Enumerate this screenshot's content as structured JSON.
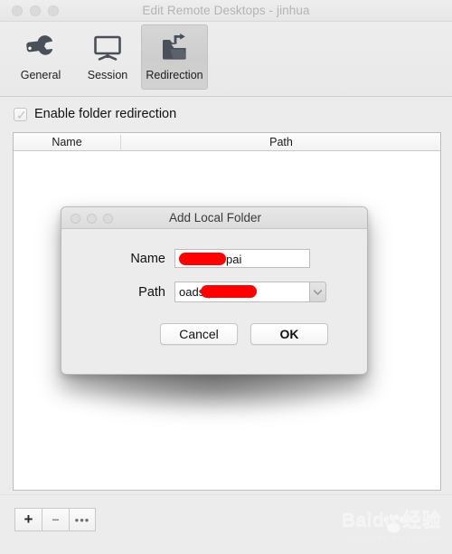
{
  "window": {
    "title": "Edit Remote Desktops - jinhua",
    "traffic_lights": [
      "close-button",
      "minimize-button",
      "zoom-button"
    ]
  },
  "toolbar": {
    "items": [
      {
        "label": "General",
        "icon": "wrench-icon",
        "selected": false
      },
      {
        "label": "Session",
        "icon": "monitor-icon",
        "selected": false
      },
      {
        "label": "Redirection",
        "icon": "folder-export-icon",
        "selected": true
      }
    ]
  },
  "options": {
    "enable_redirection_label": "Enable folder redirection",
    "enable_redirection_checked": true,
    "checkmark": "✓"
  },
  "table": {
    "columns": [
      "Name",
      "Path"
    ],
    "rows": []
  },
  "bottom_toolbar": {
    "buttons": [
      {
        "label": "+",
        "name": "add-folder-button"
      },
      {
        "label": "−",
        "name": "remove-folder-button"
      },
      {
        "label": "•••",
        "name": "more-options-button"
      }
    ]
  },
  "watermark": {
    "main": "Baidu 经验",
    "sub": "jingyan.baidu.com"
  },
  "dialog": {
    "title": "Add Local Folder",
    "fields": [
      {
        "label": "Name",
        "value": "pai",
        "redacted": true,
        "name": "folder-name-field"
      },
      {
        "label": "Path",
        "value": "oads              pai",
        "redacted": true,
        "name": "folder-path-field",
        "has_dropdown": true
      }
    ],
    "buttons": [
      {
        "label": "Cancel",
        "name": "cancel-button",
        "default": false
      },
      {
        "label": "OK",
        "name": "ok-button",
        "default": true
      }
    ]
  },
  "colors": {
    "redaction": "#fe0000",
    "window_bg": "#ececec",
    "selected_tab": "#d0d0d0"
  }
}
